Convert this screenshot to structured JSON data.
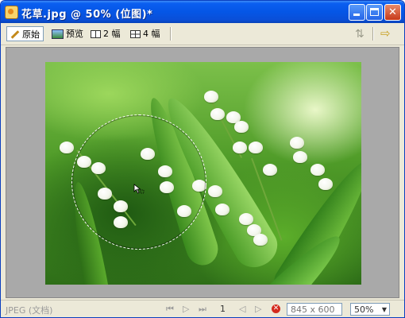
{
  "window": {
    "title": "花草.jpg @  50% (位图)*",
    "icons": [
      "app-icon",
      "minimize-icon",
      "maximize-icon",
      "close-icon"
    ]
  },
  "toolbar": {
    "tabs": [
      {
        "label": "原始",
        "icon": "pencil-icon",
        "active": true
      },
      {
        "label": "预览",
        "icon": "preview-icon",
        "active": false
      },
      {
        "label": "2 幅",
        "icon": "two-panel-icon",
        "active": false
      },
      {
        "label": "4 幅",
        "icon": "four-panel-icon",
        "active": false
      }
    ],
    "right_icons": [
      "sort-arrows-icon",
      "export-arrow-icon"
    ]
  },
  "status": {
    "format": "JPEG (文档)",
    "page": "1",
    "dimensions": "845 x 600",
    "zoom": "50%",
    "nav_icons": [
      "first-frame-icon",
      "play-icon",
      "last-frame-icon",
      "prev-frame-icon",
      "next-frame-icon",
      "stop-icon"
    ]
  },
  "colors": {
    "titlebar": "#0556e6",
    "chrome": "#ece9d8",
    "canvas_bg": "#a9a9a9"
  }
}
